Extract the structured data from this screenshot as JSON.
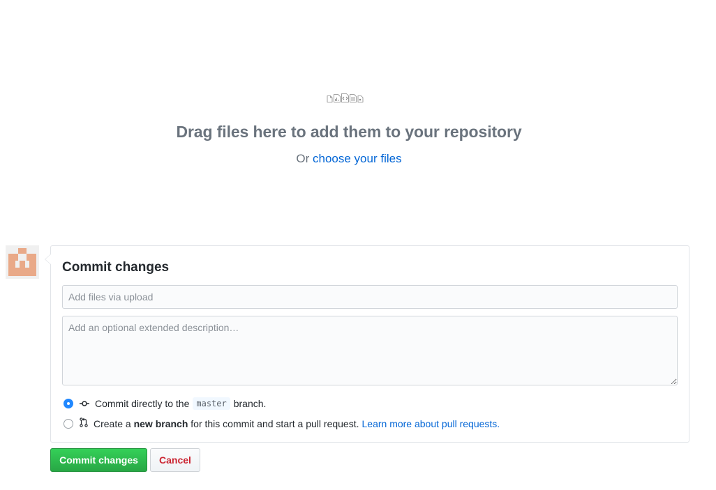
{
  "dropzone": {
    "title": "Drag files here to add them to your repository",
    "prefix": "Or",
    "choose_link": "choose your files",
    "icons": [
      "file-icon",
      "file-chart-icon",
      "file-code-icon",
      "file-text-icon",
      "file-media-icon"
    ]
  },
  "commit": {
    "title": "Commit changes",
    "summary_placeholder": "Add files via upload",
    "description_placeholder": "Add an optional extended description…",
    "options": [
      {
        "selected": true,
        "icon": "git-commit-icon",
        "text_before": "Commit directly to the",
        "branch": "master",
        "text_after": "branch."
      },
      {
        "selected": false,
        "icon": "git-pull-request-icon",
        "text_before": "Create a",
        "bold": "new branch",
        "text_after": "for this commit and start a pull request.",
        "link": "Learn more about pull requests."
      }
    ]
  },
  "buttons": {
    "commit": "Commit changes",
    "cancel": "Cancel"
  },
  "colors": {
    "link": "#0366d6",
    "primary": "#28a745",
    "danger": "#cb2431",
    "avatar": "#e9a988"
  }
}
